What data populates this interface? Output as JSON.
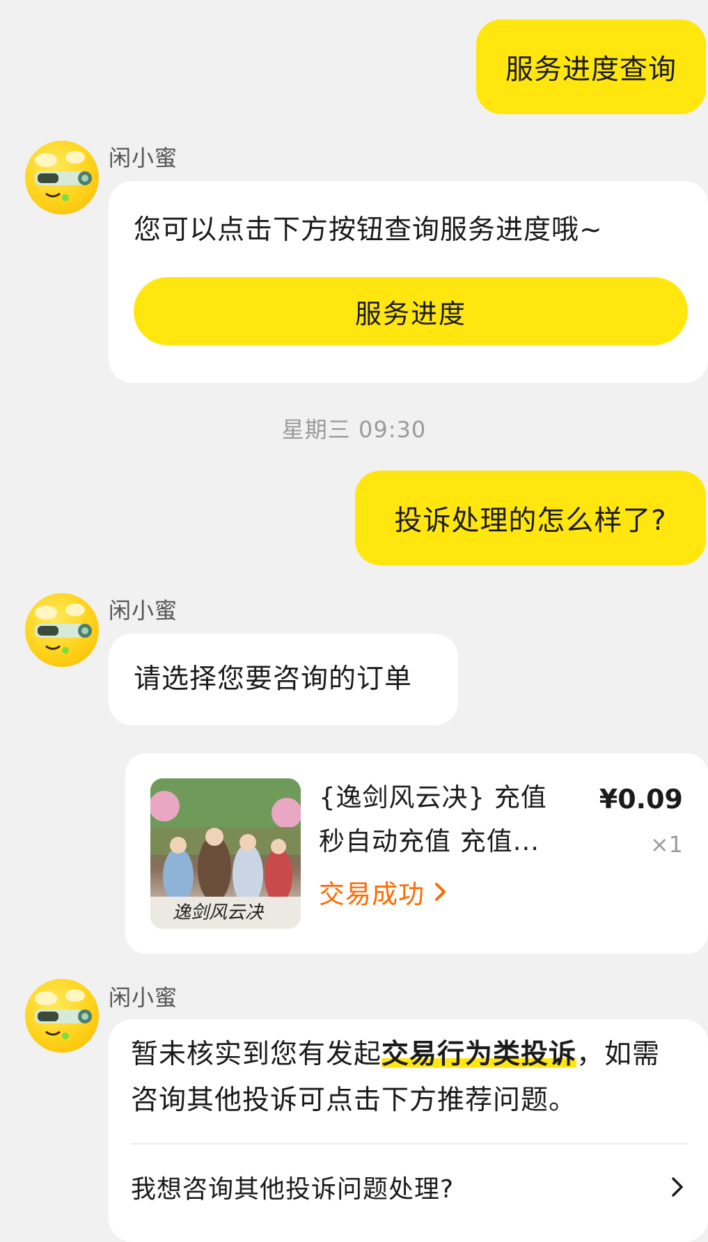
{
  "messages": {
    "msg1_out": "服务进度查询",
    "msg2": {
      "sender": "闲小蜜",
      "text": "您可以点击下方按钮查询服务进度哦~",
      "button_label": "服务进度"
    },
    "timestamp": "星期三 09:30",
    "msg3_out": "投诉处理的怎么样了?",
    "msg4": {
      "sender": "闲小蜜",
      "text": "请选择您要咨询的订单"
    },
    "order": {
      "title_line1": "{逸剑风云决} 充值",
      "title_line2": "秒自动充值 充值...",
      "price": "¥0.09",
      "quantity": "×1",
      "status": "交易成功",
      "thumb_caption": "逸剑风云决"
    },
    "msg5": {
      "sender": "闲小蜜",
      "text_before": "暂未核实到您有发起",
      "text_highlight": "交易行为类投诉",
      "text_after": "，如需咨询其他投诉可点击下方推荐问题。",
      "faq_item": "我想咨询其他投诉问题处理?"
    }
  },
  "colors": {
    "accent_yellow": "#ffe60f",
    "status_orange": "#ff6a00",
    "background": "#f1f1f1"
  },
  "icons": {
    "avatar": "robot-mascot-icon",
    "status_arrow": "chevron-right-icon",
    "faq_arrow": "chevron-right-icon"
  }
}
